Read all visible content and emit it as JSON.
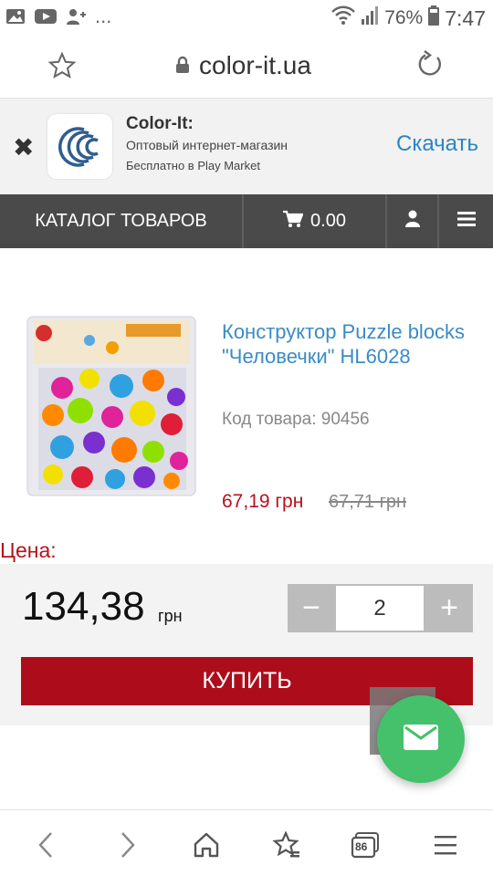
{
  "status_bar": {
    "left_icons": [
      "image-icon",
      "youtube-icon",
      "person-add-icon"
    ],
    "more": "...",
    "battery": "76%",
    "time": "7:47"
  },
  "address_bar": {
    "url": "color-it.ua"
  },
  "app_banner": {
    "title": "Color-It:",
    "subtitle": "Оптовый интернет-магазин",
    "note": "Бесплатно в Play Market",
    "download": "Скачать",
    "close": "✖"
  },
  "nav": {
    "catalog": "КАТАЛОГ ТОВАРОВ",
    "cart_total": "0.00"
  },
  "product": {
    "title": "Конструктор Puzzle blocks \"Человечки\" HL6028",
    "code": "Код товара: 90456",
    "price": "67,19 грн",
    "old_price": "67,71 грн",
    "image_name": "puzzle-blocks-package-image"
  },
  "buy": {
    "price_label": "Цена:",
    "total": "134,38",
    "currency": "грн",
    "minus": "−",
    "quantity": "2",
    "plus": "+",
    "buy_button": "КУПИТЬ"
  },
  "bottom_bar": {
    "tabs_count": "86"
  },
  "colors": {
    "accent_red": "#ad0d1b",
    "price_red": "#b5121b",
    "link_blue": "#3b8bc6",
    "download_blue": "#2a86c4",
    "nav_bg": "#4a4a4a",
    "fab_green": "#45c06b"
  }
}
